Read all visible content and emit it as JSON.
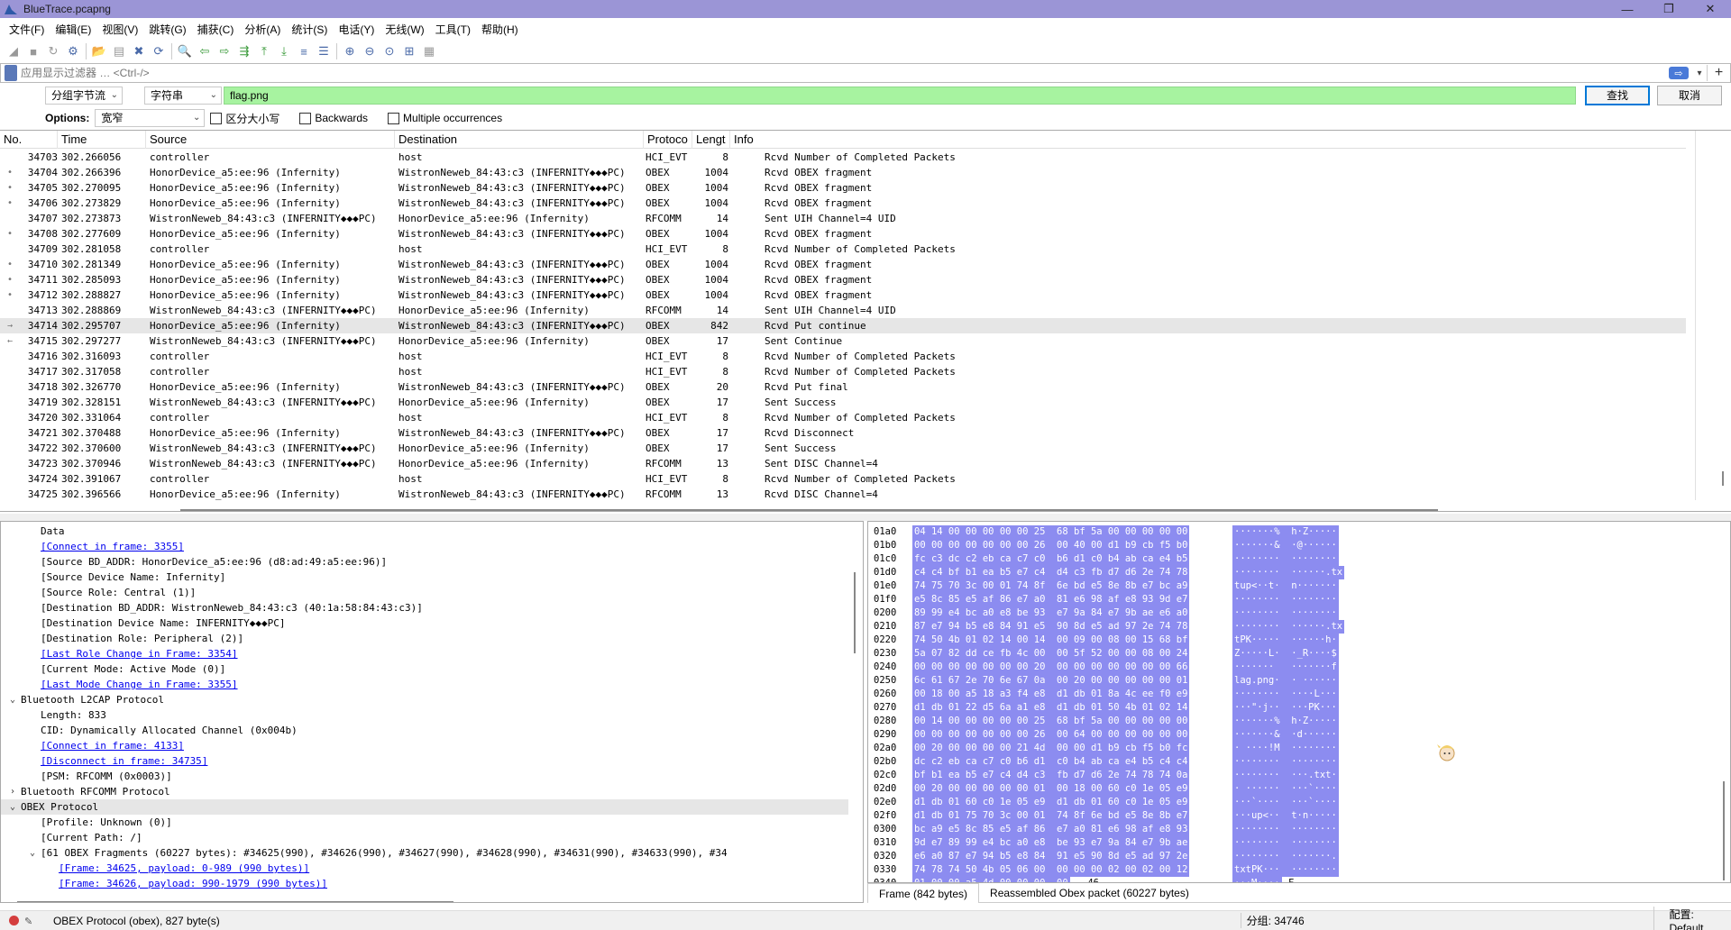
{
  "window": {
    "title": "BlueTrace.pcapng",
    "minimize": "—",
    "maximize": "❐",
    "close": "✕"
  },
  "menu": [
    "文件(F)",
    "编辑(E)",
    "视图(V)",
    "跳转(G)",
    "捕获(C)",
    "分析(A)",
    "统计(S)",
    "电话(Y)",
    "无线(W)",
    "工具(T)",
    "帮助(H)"
  ],
  "toolbar": [
    {
      "name": "start-capture-icon",
      "glyph": "◢"
    },
    {
      "name": "stop-capture-icon",
      "glyph": "■"
    },
    {
      "name": "restart-capture-icon",
      "glyph": "↻"
    },
    {
      "name": "capture-options-icon",
      "glyph": "⚙"
    },
    {
      "name": "open-file-icon",
      "glyph": "📂"
    },
    {
      "name": "save-file-icon",
      "glyph": "▤"
    },
    {
      "name": "close-file-icon",
      "glyph": "✖"
    },
    {
      "name": "reload-file-icon",
      "glyph": "⟳"
    },
    {
      "name": "find-packet-icon",
      "glyph": "🔍"
    },
    {
      "name": "go-back-icon",
      "glyph": "⇦"
    },
    {
      "name": "go-forward-icon",
      "glyph": "⇨"
    },
    {
      "name": "go-to-packet-icon",
      "glyph": "⇶"
    },
    {
      "name": "go-first-icon",
      "glyph": "⤒"
    },
    {
      "name": "go-last-icon",
      "glyph": "⤓"
    },
    {
      "name": "auto-scroll-icon",
      "glyph": "≡"
    },
    {
      "name": "colorize-icon",
      "glyph": "☰"
    },
    {
      "name": "zoom-in-icon",
      "glyph": "⊕"
    },
    {
      "name": "zoom-out-icon",
      "glyph": "⊖"
    },
    {
      "name": "zoom-normal-icon",
      "glyph": "⊙"
    },
    {
      "name": "resize-columns-icon",
      "glyph": "⊞"
    },
    {
      "name": "layout-icon",
      "glyph": "▦"
    }
  ],
  "filter": {
    "placeholder": "应用显示过滤器 … <Ctrl-/>",
    "apply": "⇨",
    "dropdown": "▾",
    "add": "+"
  },
  "find": {
    "scope": "分组字节流",
    "type": "字符串",
    "value": "flag.png",
    "find_button": "查找",
    "cancel_button": "取消",
    "options_label": "Options:",
    "charset": "宽窄",
    "case_label": "区分大小写",
    "backwards_label": "Backwards",
    "multi_label": "Multiple occurrences",
    "arrow": "⌄"
  },
  "packet_list": {
    "columns": [
      "No.",
      "Time",
      "Source",
      "Destination",
      "Protoco",
      "Lengt",
      "Info"
    ],
    "rows": [
      {
        "mark": "",
        "no": "34703",
        "time": "302.266056",
        "src": "controller",
        "dst": "host",
        "proto": "HCI_EVT",
        "len": "8",
        "info": "Rcvd Number of Completed Packets"
      },
      {
        "mark": "•",
        "no": "34704",
        "time": "302.266396",
        "src": "HonorDevice_a5:ee:96 (Infernity)",
        "dst": "WistronNeweb_84:43:c3 (INFERNITY◆◆◆PC)",
        "proto": "OBEX",
        "len": "1004",
        "info": "Rcvd OBEX fragment"
      },
      {
        "mark": "•",
        "no": "34705",
        "time": "302.270095",
        "src": "HonorDevice_a5:ee:96 (Infernity)",
        "dst": "WistronNeweb_84:43:c3 (INFERNITY◆◆◆PC)",
        "proto": "OBEX",
        "len": "1004",
        "info": "Rcvd OBEX fragment"
      },
      {
        "mark": "•",
        "no": "34706",
        "time": "302.273829",
        "src": "HonorDevice_a5:ee:96 (Infernity)",
        "dst": "WistronNeweb_84:43:c3 (INFERNITY◆◆◆PC)",
        "proto": "OBEX",
        "len": "1004",
        "info": "Rcvd OBEX fragment"
      },
      {
        "mark": "",
        "no": "34707",
        "time": "302.273873",
        "src": "WistronNeweb_84:43:c3 (INFERNITY◆◆◆PC)",
        "dst": "HonorDevice_a5:ee:96 (Infernity)",
        "proto": "RFCOMM",
        "len": "14",
        "info": "Sent UIH Channel=4 UID"
      },
      {
        "mark": "•",
        "no": "34708",
        "time": "302.277609",
        "src": "HonorDevice_a5:ee:96 (Infernity)",
        "dst": "WistronNeweb_84:43:c3 (INFERNITY◆◆◆PC)",
        "proto": "OBEX",
        "len": "1004",
        "info": "Rcvd OBEX fragment"
      },
      {
        "mark": "",
        "no": "34709",
        "time": "302.281058",
        "src": "controller",
        "dst": "host",
        "proto": "HCI_EVT",
        "len": "8",
        "info": "Rcvd Number of Completed Packets"
      },
      {
        "mark": "•",
        "no": "34710",
        "time": "302.281349",
        "src": "HonorDevice_a5:ee:96 (Infernity)",
        "dst": "WistronNeweb_84:43:c3 (INFERNITY◆◆◆PC)",
        "proto": "OBEX",
        "len": "1004",
        "info": "Rcvd OBEX fragment"
      },
      {
        "mark": "•",
        "no": "34711",
        "time": "302.285093",
        "src": "HonorDevice_a5:ee:96 (Infernity)",
        "dst": "WistronNeweb_84:43:c3 (INFERNITY◆◆◆PC)",
        "proto": "OBEX",
        "len": "1004",
        "info": "Rcvd OBEX fragment"
      },
      {
        "mark": "•",
        "no": "34712",
        "time": "302.288827",
        "src": "HonorDevice_a5:ee:96 (Infernity)",
        "dst": "WistronNeweb_84:43:c3 (INFERNITY◆◆◆PC)",
        "proto": "OBEX",
        "len": "1004",
        "info": "Rcvd OBEX fragment"
      },
      {
        "mark": "",
        "no": "34713",
        "time": "302.288869",
        "src": "WistronNeweb_84:43:c3 (INFERNITY◆◆◆PC)",
        "dst": "HonorDevice_a5:ee:96 (Infernity)",
        "proto": "RFCOMM",
        "len": "14",
        "info": "Sent UIH Channel=4 UID"
      },
      {
        "mark": "→",
        "no": "34714",
        "time": "302.295707",
        "src": "HonorDevice_a5:ee:96 (Infernity)",
        "dst": "WistronNeweb_84:43:c3 (INFERNITY◆◆◆PC)",
        "proto": "OBEX",
        "len": "842",
        "info": "Rcvd Put continue",
        "selected": true
      },
      {
        "mark": "←",
        "no": "34715",
        "time": "302.297277",
        "src": "WistronNeweb_84:43:c3 (INFERNITY◆◆◆PC)",
        "dst": "HonorDevice_a5:ee:96 (Infernity)",
        "proto": "OBEX",
        "len": "17",
        "info": "Sent Continue"
      },
      {
        "mark": "",
        "no": "34716",
        "time": "302.316093",
        "src": "controller",
        "dst": "host",
        "proto": "HCI_EVT",
        "len": "8",
        "info": "Rcvd Number of Completed Packets"
      },
      {
        "mark": "",
        "no": "34717",
        "time": "302.317058",
        "src": "controller",
        "dst": "host",
        "proto": "HCI_EVT",
        "len": "8",
        "info": "Rcvd Number of Completed Packets"
      },
      {
        "mark": "",
        "no": "34718",
        "time": "302.326770",
        "src": "HonorDevice_a5:ee:96 (Infernity)",
        "dst": "WistronNeweb_84:43:c3 (INFERNITY◆◆◆PC)",
        "proto": "OBEX",
        "len": "20",
        "info": "Rcvd Put final"
      },
      {
        "mark": "",
        "no": "34719",
        "time": "302.328151",
        "src": "WistronNeweb_84:43:c3 (INFERNITY◆◆◆PC)",
        "dst": "HonorDevice_a5:ee:96 (Infernity)",
        "proto": "OBEX",
        "len": "17",
        "info": "Sent Success"
      },
      {
        "mark": "",
        "no": "34720",
        "time": "302.331064",
        "src": "controller",
        "dst": "host",
        "proto": "HCI_EVT",
        "len": "8",
        "info": "Rcvd Number of Completed Packets"
      },
      {
        "mark": "",
        "no": "34721",
        "time": "302.370488",
        "src": "HonorDevice_a5:ee:96 (Infernity)",
        "dst": "WistronNeweb_84:43:c3 (INFERNITY◆◆◆PC)",
        "proto": "OBEX",
        "len": "17",
        "info": "Rcvd Disconnect"
      },
      {
        "mark": "",
        "no": "34722",
        "time": "302.370600",
        "src": "WistronNeweb_84:43:c3 (INFERNITY◆◆◆PC)",
        "dst": "HonorDevice_a5:ee:96 (Infernity)",
        "proto": "OBEX",
        "len": "17",
        "info": "Sent Success"
      },
      {
        "mark": "",
        "no": "34723",
        "time": "302.370946",
        "src": "WistronNeweb_84:43:c3 (INFERNITY◆◆◆PC)",
        "dst": "HonorDevice_a5:ee:96 (Infernity)",
        "proto": "RFCOMM",
        "len": "13",
        "info": "Sent DISC Channel=4"
      },
      {
        "mark": "",
        "no": "34724",
        "time": "302.391067",
        "src": "controller",
        "dst": "host",
        "proto": "HCI_EVT",
        "len": "8",
        "info": "Rcvd Number of Completed Packets"
      },
      {
        "mark": "",
        "no": "34725",
        "time": "302.396566",
        "src": "HonorDevice_a5:ee:96 (Infernity)",
        "dst": "WistronNeweb_84:43:c3 (INFERNITY◆◆◆PC)",
        "proto": "RFCOMM",
        "len": "13",
        "info": "Rcvd DISC Channel=4"
      }
    ]
  },
  "details": [
    {
      "indent": 2,
      "text": "Data",
      "tog": ""
    },
    {
      "indent": 2,
      "text": "[Connect in frame: 3355]",
      "link": true
    },
    {
      "indent": 2,
      "text": "[Source BD_ADDR: HonorDevice_a5:ee:96 (d8:ad:49:a5:ee:96)]"
    },
    {
      "indent": 2,
      "text": "[Source Device Name: Infernity]"
    },
    {
      "indent": 2,
      "text": "[Source Role: Central (1)]"
    },
    {
      "indent": 2,
      "text": "[Destination BD_ADDR: WistronNeweb_84:43:c3 (40:1a:58:84:43:c3)]"
    },
    {
      "indent": 2,
      "text": "[Destination Device Name: INFERNITY◆◆◆PC]"
    },
    {
      "indent": 2,
      "text": "[Destination Role: Peripheral (2)]"
    },
    {
      "indent": 2,
      "text": "[Last Role Change in Frame: 3354]",
      "link": true
    },
    {
      "indent": 2,
      "text": "[Current Mode: Active Mode (0)]"
    },
    {
      "indent": 2,
      "text": "[Last Mode Change in Frame: 3355]",
      "link": true
    },
    {
      "indent": 1,
      "text": "Bluetooth L2CAP Protocol",
      "tog": "⌄"
    },
    {
      "indent": 2,
      "text": "Length: 833"
    },
    {
      "indent": 2,
      "text": "CID: Dynamically Allocated Channel (0x004b)"
    },
    {
      "indent": 2,
      "text": "[Connect in frame: 4133]",
      "link": true
    },
    {
      "indent": 2,
      "text": "[Disconnect in frame: 34735]",
      "link": true
    },
    {
      "indent": 2,
      "text": "[PSM: RFCOMM (0x0003)]"
    },
    {
      "indent": 1,
      "text": "Bluetooth RFCOMM Protocol",
      "tog": "›"
    },
    {
      "indent": 1,
      "text": "OBEX Protocol",
      "tog": "⌄",
      "hl": true
    },
    {
      "indent": 2,
      "text": "[Profile: Unknown (0)]"
    },
    {
      "indent": 2,
      "text": "[Current Path: /]"
    },
    {
      "indent": 2,
      "text": "[61 OBEX Fragments (60227 bytes): #34625(990), #34626(990), #34627(990), #34628(990), #34631(990), #34633(990), #34",
      "tog": "⌄"
    },
    {
      "indent": 3,
      "text": "[Frame: 34625, payload: 0-989 (990 bytes)]",
      "link": true
    },
    {
      "indent": 3,
      "text": "[Frame: 34626, payload: 990-1979 (990 bytes)]",
      "link": true
    }
  ],
  "bytes": [
    {
      "off": "01a0",
      "hex": "04 14 00 00 00 00 00 25  68 bf 5a 00 00 00 00 00",
      "asc": "·······%  h·Z·····"
    },
    {
      "off": "01b0",
      "hex": "00 00 00 00 00 00 00 26  00 40 00 d1 b9 cb f5 b0",
      "asc": "·······&  ·@······"
    },
    {
      "off": "01c0",
      "hex": "fc c3 dc c2 eb ca c7 c0  b6 d1 c0 b4 ab ca e4 b5",
      "asc": "········  ········"
    },
    {
      "off": "01d0",
      "hex": "c4 c4 bf b1 ea b5 e7 c4  d4 c3 fb d7 d6 2e 74 78",
      "asc": "········  ······.tx"
    },
    {
      "off": "01e0",
      "hex": "74 75 70 3c 00 01 74 8f  6e bd e5 8e 8b e7 bc a9",
      "asc": "tup<··t·  n·······"
    },
    {
      "off": "01f0",
      "hex": "e5 8c 85 e5 af 86 e7 a0  81 e6 98 af e8 93 9d e7",
      "asc": "········  ········"
    },
    {
      "off": "0200",
      "hex": "89 99 e4 bc a0 e8 be 93  e7 9a 84 e7 9b ae e6 a0",
      "asc": "········  ········"
    },
    {
      "off": "0210",
      "hex": "87 e7 94 b5 e8 84 91 e5  90 8d e5 ad 97 2e 74 78",
      "asc": "········  ······.tx"
    },
    {
      "off": "0220",
      "hex": "74 50 4b 01 02 14 00 14  00 09 00 08 00 15 68 bf",
      "asc": "tPK·····  ······h·"
    },
    {
      "off": "0230",
      "hex": "5a 07 82 dd ce fb 4c 00  00 5f 52 00 00 08 00 24",
      "asc": "Z·····L·  ·_R····$"
    },
    {
      "off": "0240",
      "hex": "00 00 00 00 00 00 00 20  00 00 00 00 00 00 00 66",
      "asc": "·······   ·······f"
    },
    {
      "off": "0250",
      "hex": "6c 61 67 2e 70 6e 67 0a  00 20 00 00 00 00 00 01",
      "asc": "lag.png·  · ······"
    },
    {
      "off": "0260",
      "hex": "00 18 00 a5 18 a3 f4 e8  d1 db 01 8a 4c ee f0 e9",
      "asc": "········  ····L···"
    },
    {
      "off": "0270",
      "hex": "d1 db 01 22 d5 6a a1 e8  d1 db 01 50 4b 01 02 14",
      "asc": "···\"·j··  ···PK···"
    },
    {
      "off": "0280",
      "hex": "00 14 00 00 00 00 00 25  68 bf 5a 00 00 00 00 00",
      "asc": "·······%  h·Z·····"
    },
    {
      "off": "0290",
      "hex": "00 00 00 00 00 00 00 26  00 64 00 00 00 00 00 00",
      "asc": "·······&  ·d······"
    },
    {
      "off": "02a0",
      "hex": "00 20 00 00 00 00 21 4d  00 00 d1 b9 cb f5 b0 fc",
      "asc": "· ····!M  ········"
    },
    {
      "off": "02b0",
      "hex": "dc c2 eb ca c7 c0 b6 d1  c0 b4 ab ca e4 b5 c4 c4",
      "asc": "········  ········"
    },
    {
      "off": "02c0",
      "hex": "bf b1 ea b5 e7 c4 d4 c3  fb d7 d6 2e 74 78 74 0a",
      "asc": "········  ···.txt·"
    },
    {
      "off": "02d0",
      "hex": "00 20 00 00 00 00 00 01  00 18 00 60 c0 1e 05 e9",
      "asc": "· ······  ···`····"
    },
    {
      "off": "02e0",
      "hex": "d1 db 01 60 c0 1e 05 e9  d1 db 01 60 c0 1e 05 e9",
      "asc": "···`····  ···`····"
    },
    {
      "off": "02f0",
      "hex": "d1 db 01 75 70 3c 00 01  74 8f 6e bd e5 8e 8b e7",
      "asc": "···up<··  t·n·····"
    },
    {
      "off": "0300",
      "hex": "bc a9 e5 8c 85 e5 af 86  e7 a0 81 e6 98 af e8 93",
      "asc": "········  ········"
    },
    {
      "off": "0310",
      "hex": "9d e7 89 99 e4 bc a0 e8  be 93 e7 9a 84 e7 9b ae",
      "asc": "········  ········"
    },
    {
      "off": "0320",
      "hex": "e6 a0 87 e7 94 b5 e8 84  91 e5 90 8d e5 ad 97 2e",
      "asc": "········  ·······."
    },
    {
      "off": "0330",
      "hex": "74 78 74 50 4b 05 06 00  00 00 00 02 00 02 00 12",
      "asc": "txtPK···  ········"
    },
    {
      "off": "0340",
      "hex": "01 00 00 a5 4d 00 00 00  00",
      "hexplain": " 46",
      "asc": "···M····",
      "ascplain": "F"
    }
  ],
  "byte_tabs": [
    "Frame (842 bytes)",
    "Reassembled Obex packet (60227 bytes)"
  ],
  "status": {
    "left": "OBEX Protocol (obex), 827 byte(s)",
    "packets": "分组: 34746",
    "profile": "配置: Default"
  }
}
